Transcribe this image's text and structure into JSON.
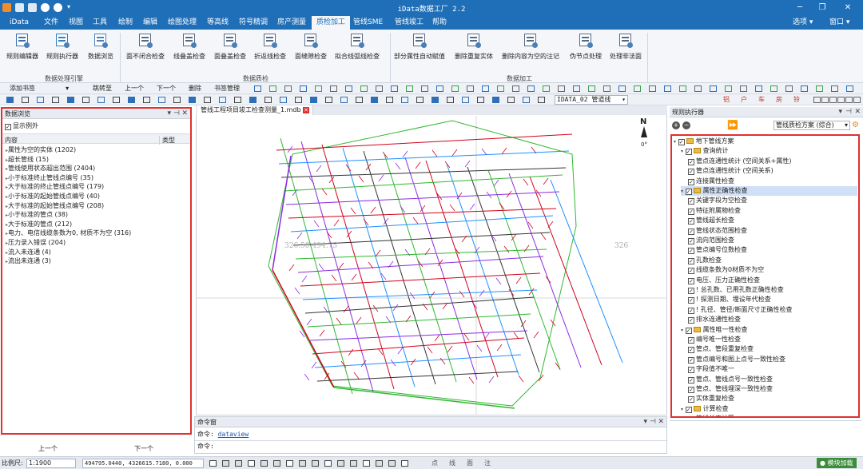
{
  "app": {
    "title": "iData数据工厂 2.2"
  },
  "window": {
    "minimize": "─",
    "restore": "❐",
    "close": "✕"
  },
  "menubar": {
    "items": [
      "iData",
      "文件",
      "视图",
      "工具",
      "绘制",
      "编辑",
      "绘图处理",
      "等高线",
      "符号精调",
      "房产测量",
      "质检加工",
      "管线SME",
      "管线竣工",
      "帮助"
    ],
    "active_index": 10,
    "options": "选项",
    "window": "窗口"
  },
  "ribbon": {
    "buttons": [
      "规则编辑器",
      "规则执行器",
      "数据浏览",
      "面不闭合检查",
      "线叠盖检查",
      "面叠盖检查",
      "折返线检查",
      "面缝隙检查",
      "拟合线弧线检查",
      "部分属性自动赋值",
      "删除重复实体",
      "删除内容为空的注记",
      "伪节点处理",
      "处理非法面"
    ],
    "groups": [
      "数据处理引擎",
      "数据质检",
      "数据加工"
    ]
  },
  "toolbar1": {
    "add_bookmark": "添加书签",
    "goto": "跳转至",
    "prev": "上一个",
    "next": "下一个",
    "delete": "删除",
    "bookmark_manage": "书签管理"
  },
  "toolbar2": {
    "layer_select": "IDATA_02 管道线",
    "right_glyphs": [
      "铝",
      "户",
      "车",
      "房",
      "铃"
    ]
  },
  "left_panel": {
    "title": "数据浏览",
    "show_exceptions": "显示例外",
    "col_content": "内容",
    "col_type": "类型",
    "rows": [
      "属性为空的实体 (1202)",
      "超长管线 (15)",
      "管线使用状态超出范围 (2404)",
      "小于标准终止管线点编号 (35)",
      "大于标准的终止管线点编号 (179)",
      "小于标准的起始管线点编号 (40)",
      "大于标准的起始管线点编号 (208)",
      "小于标准的管点 (38)",
      "大于标准的管点 (212)",
      "电力、电信线缆条数为0, 材质不为空 (316)",
      "压力录入错误 (204)",
      "流入未连通 (4)",
      "流出未连通 (3)"
    ],
    "prev": "上一个",
    "next": "下一个"
  },
  "document": {
    "tab": "管线工程项目竣工检查测量_1.mdb",
    "coord_left": "326.50-494.75",
    "coord_right": "326",
    "north": "N",
    "rotation": "0°"
  },
  "command": {
    "title": "命令窗",
    "line1_prefix": "命令:",
    "line1_cmd": "dataview",
    "line2_prefix": "命令:"
  },
  "right_panel": {
    "title": "规则执行器",
    "scheme_select": "管线质检方案 (综合)",
    "tree": [
      {
        "level": 0,
        "label": "地下管线方案",
        "folder": true
      },
      {
        "level": 1,
        "label": "查询统计",
        "folder": true
      },
      {
        "level": 2,
        "label": "管点连通性统计 (空间关系+属性)"
      },
      {
        "level": 2,
        "label": "管点连通性统计 (空间关系)"
      },
      {
        "level": 2,
        "label": "连接属性检查"
      },
      {
        "level": 1,
        "label": "属性正确性检查",
        "folder": true,
        "selected": true
      },
      {
        "level": 2,
        "label": "关键字段为空检查"
      },
      {
        "level": 2,
        "label": "特征附属物检查"
      },
      {
        "level": 2,
        "label": "管线超长检查"
      },
      {
        "level": 2,
        "label": "管线状态范围检查"
      },
      {
        "level": 2,
        "label": "流向范围检查"
      },
      {
        "level": 2,
        "label": "管点编号位数检查"
      },
      {
        "level": 2,
        "label": "孔数检查"
      },
      {
        "level": 2,
        "label": "线缆条数为0材质不为空"
      },
      {
        "level": 2,
        "label": "电压、压力正确性检查"
      },
      {
        "level": 2,
        "label": "! 总孔数、已用孔数正确性检查"
      },
      {
        "level": 2,
        "label": "! 探测日期、埋设年代检查"
      },
      {
        "level": 2,
        "label": "! 孔径、管径/断面尺寸正确性检查"
      },
      {
        "level": 2,
        "label": "排水连通性检查"
      },
      {
        "level": 1,
        "label": "属性唯一性检查",
        "folder": true
      },
      {
        "level": 2,
        "label": "编号唯一性检查"
      },
      {
        "level": 2,
        "label": "管点、管段重复检查"
      },
      {
        "level": 2,
        "label": "管点编号和图上点号一致性检查"
      },
      {
        "level": 2,
        "label": "字段值不唯一"
      },
      {
        "level": 2,
        "label": "管点、管线点号一致性检查"
      },
      {
        "level": 2,
        "label": "管点、管线埋深一致性检查"
      },
      {
        "level": 2,
        "label": "实体重复检查"
      },
      {
        "level": 1,
        "label": "计算检查",
        "folder": true
      },
      {
        "level": 2,
        "label": "管线长度计算"
      }
    ]
  },
  "status": {
    "scale_label": "比例尺:",
    "scale_value": "1:1900",
    "coords": "494795.0440, 4326615.7180, 0.000",
    "modes": [
      "点",
      "线",
      "面",
      "注"
    ],
    "plugin": "模块加载"
  },
  "colors": {
    "title_bg": "#1f6fb8",
    "highlight_red": "#e03030",
    "line_green": "#2fb82f",
    "line_purple": "#8a2be2",
    "line_red": "#d0021b",
    "line_blue": "#1e90ff"
  }
}
